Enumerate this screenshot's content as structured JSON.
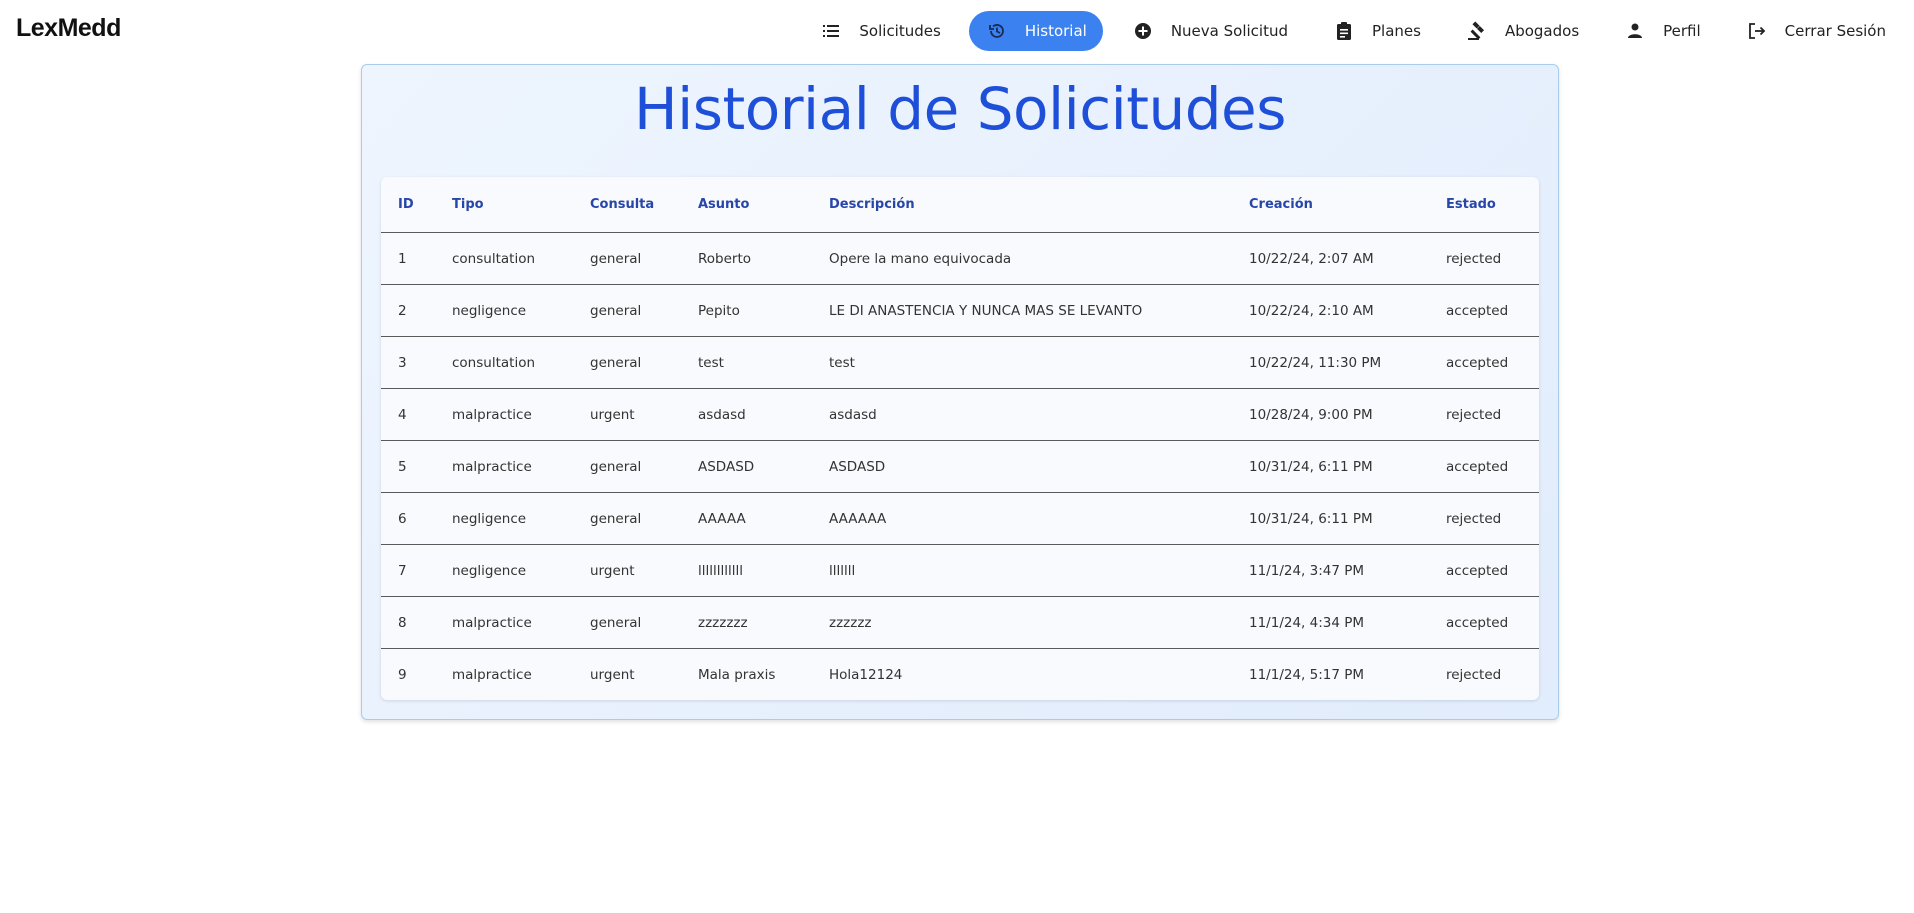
{
  "brand": "LexMedd",
  "nav": [
    {
      "label": "Solicitudes",
      "icon": "list-icon",
      "active": false
    },
    {
      "label": "Historial",
      "icon": "history-icon",
      "active": true
    },
    {
      "label": "Nueva Solicitud",
      "icon": "add-circle-icon",
      "active": false
    },
    {
      "label": "Planes",
      "icon": "assignment-icon",
      "active": false
    },
    {
      "label": "Abogados",
      "icon": "gavel-icon",
      "active": false
    },
    {
      "label": "Perfil",
      "icon": "person-icon",
      "active": false
    },
    {
      "label": "Cerrar Sesión",
      "icon": "logout-icon",
      "active": false
    }
  ],
  "title": "Historial de Solicitudes",
  "table": {
    "headers": [
      "ID",
      "Tipo",
      "Consulta",
      "Asunto",
      "Descripción",
      "Creación",
      "Estado"
    ],
    "rows": [
      [
        "1",
        "consultation",
        "general",
        "Roberto",
        "Opere la mano equivocada",
        "10/22/24, 2:07 AM",
        "rejected"
      ],
      [
        "2",
        "negligence",
        "general",
        "Pepito",
        "LE DI ANASTENCIA Y NUNCA MAS SE LEVANTO",
        "10/22/24, 2:10 AM",
        "accepted"
      ],
      [
        "3",
        "consultation",
        "general",
        "test",
        "test",
        "10/22/24, 11:30 PM",
        "accepted"
      ],
      [
        "4",
        "malpractice",
        "urgent",
        "asdasd",
        "asdasd",
        "10/28/24, 9:00 PM",
        "rejected"
      ],
      [
        "5",
        "malpractice",
        "general",
        "ASDASD",
        "ASDASD",
        "10/31/24, 6:11 PM",
        "accepted"
      ],
      [
        "6",
        "negligence",
        "general",
        "AAAAA",
        "AAAAAA",
        "10/31/24, 6:11 PM",
        "rejected"
      ],
      [
        "7",
        "negligence",
        "urgent",
        "llllllllllll",
        "lllllll",
        "11/1/24, 3:47 PM",
        "accepted"
      ],
      [
        "8",
        "malpractice",
        "general",
        "zzzzzzz",
        "zzzzzz",
        "11/1/24, 4:34 PM",
        "accepted"
      ],
      [
        "9",
        "malpractice",
        "urgent",
        "Mala praxis",
        "Hola12124",
        "11/1/24, 5:17 PM",
        "rejected"
      ]
    ]
  },
  "colors": {
    "accent": "#3b82f0",
    "title": "#1e4fd8",
    "header_text": "#2746a8"
  }
}
